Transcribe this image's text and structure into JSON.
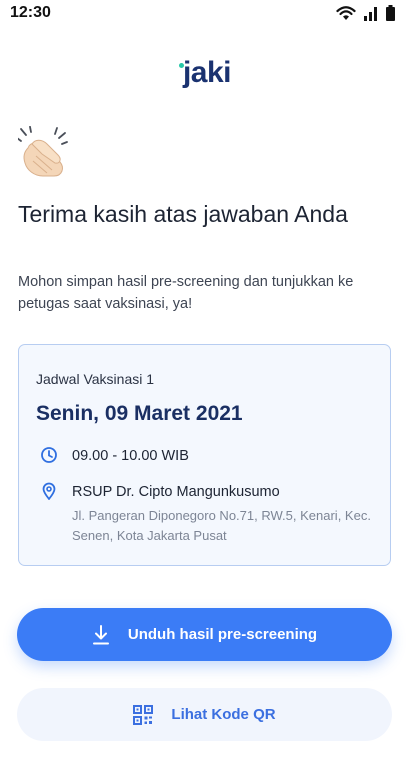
{
  "status_bar": {
    "time": "12:30",
    "icons": [
      "wifi-icon",
      "signal-icon",
      "battery-icon"
    ]
  },
  "brand": {
    "logo_text": "jaki",
    "accent_color": "#26c7a8",
    "brand_color": "#1a3270"
  },
  "hero": {
    "emoji": "clapping-hands-icon",
    "title": "Terima kasih atas jawaban Anda",
    "subtitle": "Mohon simpan hasil pre-screening dan tunjukkan ke petugas saat vaksinasi, ya!"
  },
  "schedule_card": {
    "label": "Jadwal Vaksinasi 1",
    "date": "Senin, 09 Maret 2021",
    "time": "09.00 - 10.00 WIB",
    "location_name": "RSUP Dr. Cipto Mangunkusumo",
    "location_address": "Jl. Pangeran Diponegoro No.71, RW.5, Kenari, Kec. Senen, Kota Jakarta Pusat"
  },
  "actions": {
    "download_label": "Unduh hasil pre-screening",
    "qr_label": "Lihat Kode QR",
    "primary_color": "#3b7cf6"
  }
}
